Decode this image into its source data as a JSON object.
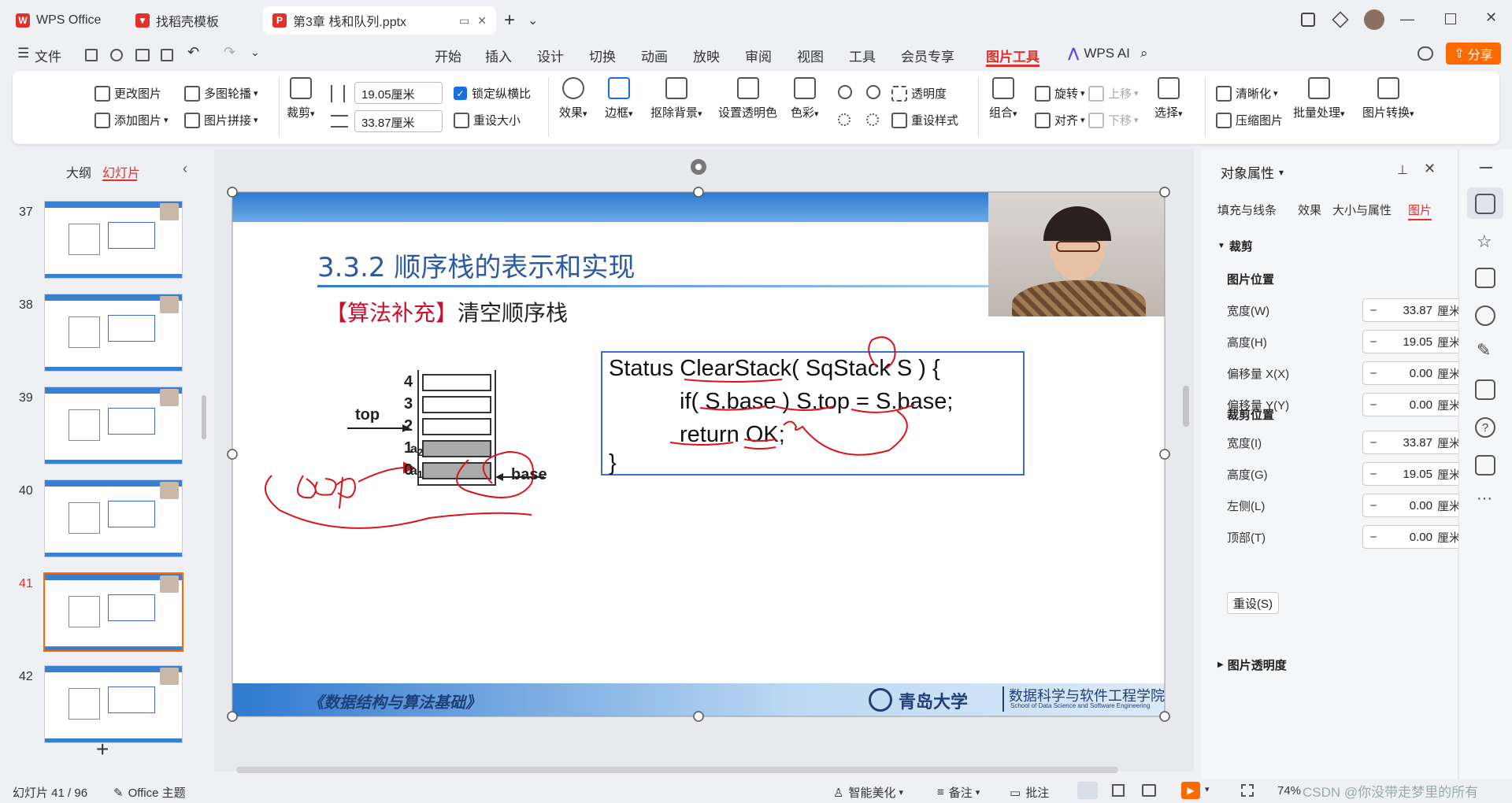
{
  "tabs": [
    {
      "label": "WPS Office",
      "color": "#e0312c",
      "glyph": "W"
    },
    {
      "label": "找稻壳模板",
      "color": "#e0312c",
      "glyph": "▼"
    },
    {
      "label": "第3章 栈和队列.pptx",
      "color": "#e0312c",
      "glyph": "P"
    }
  ],
  "titlebar": {
    "new_tab": "+",
    "dropdown": "⌄"
  },
  "menu": {
    "file": "文件",
    "items": [
      "开始",
      "插入",
      "设计",
      "切换",
      "动画",
      "放映",
      "审阅",
      "视图",
      "工具",
      "会员专享",
      "图片工具"
    ],
    "active": "图片工具",
    "wps_ai": "WPS AI",
    "share": "分享"
  },
  "ribbon": {
    "change_pic": "更改图片",
    "add_pic": "添加图片",
    "multi_carousel": "多图轮播",
    "pic_stitch": "图片拼接",
    "crop": "裁剪",
    "height_val": "19.05厘米",
    "width_val": "33.87厘米",
    "lock_ratio": "锁定纵横比",
    "reset_size": "重设大小",
    "effect": "效果",
    "border": "边框",
    "remove_bg": "抠除背景",
    "set_transparent": "设置透明色",
    "color": "色彩",
    "transparency": "透明度",
    "reset_style": "重设样式",
    "group": "组合",
    "rotate": "旋转",
    "align": "对齐",
    "move_up": "上移",
    "move_down": "下移",
    "select": "选择",
    "sharpen": "清晰化",
    "compress": "压缩图片",
    "batch": "批量处理",
    "convert": "图片转换"
  },
  "leftpanel": {
    "outline": "大纲",
    "slides": "幻灯片",
    "thumbs": [
      {
        "num": "37",
        "active": false
      },
      {
        "num": "38",
        "active": false
      },
      {
        "num": "39",
        "active": false
      },
      {
        "num": "40",
        "active": false
      },
      {
        "num": "41",
        "active": true
      },
      {
        "num": "42",
        "active": false
      }
    ],
    "add": "+"
  },
  "slide": {
    "heading": "3.3.2 顺序栈的表示和实现",
    "subtitle_bracket": "【算法补充】",
    "subtitle_text": "清空顺序栈",
    "stack_labels": [
      "4",
      "3",
      "2",
      "1",
      "0"
    ],
    "cell_a2": "a",
    "cell_a2_sub": "2",
    "cell_a1": "a",
    "cell_a1_sub": "1",
    "top_label": "top",
    "base_label": "base",
    "code": [
      "Status ClearStack( SqStack S ) {",
      "if( S.base ) S.top = S.base;",
      "return OK;",
      "}"
    ],
    "footer_left": "《数据结构与算法基础》",
    "footer_school": "数据科学与软件工程学院",
    "footer_school_en": "School of Data Science and Software Engineering",
    "footer_univ": "青岛大学"
  },
  "props": {
    "title": "对象属性",
    "tabs": [
      "填充与线条",
      "效果",
      "大小与属性",
      "图片"
    ],
    "active_tab": "图片",
    "crop_section": "裁剪",
    "pic_position": "图片位置",
    "fields1": [
      {
        "label": "宽度(W)",
        "value": "33.87",
        "unit": "厘米"
      },
      {
        "label": "高度(H)",
        "value": "19.05",
        "unit": "厘米"
      },
      {
        "label": "偏移量 X(X)",
        "value": "0.00",
        "unit": "厘米"
      },
      {
        "label": "偏移量 Y(Y)",
        "value": "0.00",
        "unit": "厘米"
      }
    ],
    "crop_position": "裁剪位置",
    "fields2": [
      {
        "label": "宽度(I)",
        "value": "33.87",
        "unit": "厘米"
      },
      {
        "label": "高度(G)",
        "value": "19.05",
        "unit": "厘米"
      },
      {
        "label": "左侧(L)",
        "value": "0.00",
        "unit": "厘米"
      },
      {
        "label": "顶部(T)",
        "value": "0.00",
        "unit": "厘米"
      }
    ],
    "reset": "重设(S)",
    "transparency": "图片透明度"
  },
  "status": {
    "slide_count": "幻灯片 41 / 96",
    "theme": "Office 主题",
    "beautify": "智能美化",
    "notes": "备注",
    "comments": "批注",
    "zoom": "74%",
    "watermark": "CSDN @你没带走梦里的所有"
  },
  "colors": {
    "accent": "#e0312c",
    "share": "#ff6a00",
    "slide_blue": "#3a7fd0",
    "pen": "#d9141a"
  }
}
